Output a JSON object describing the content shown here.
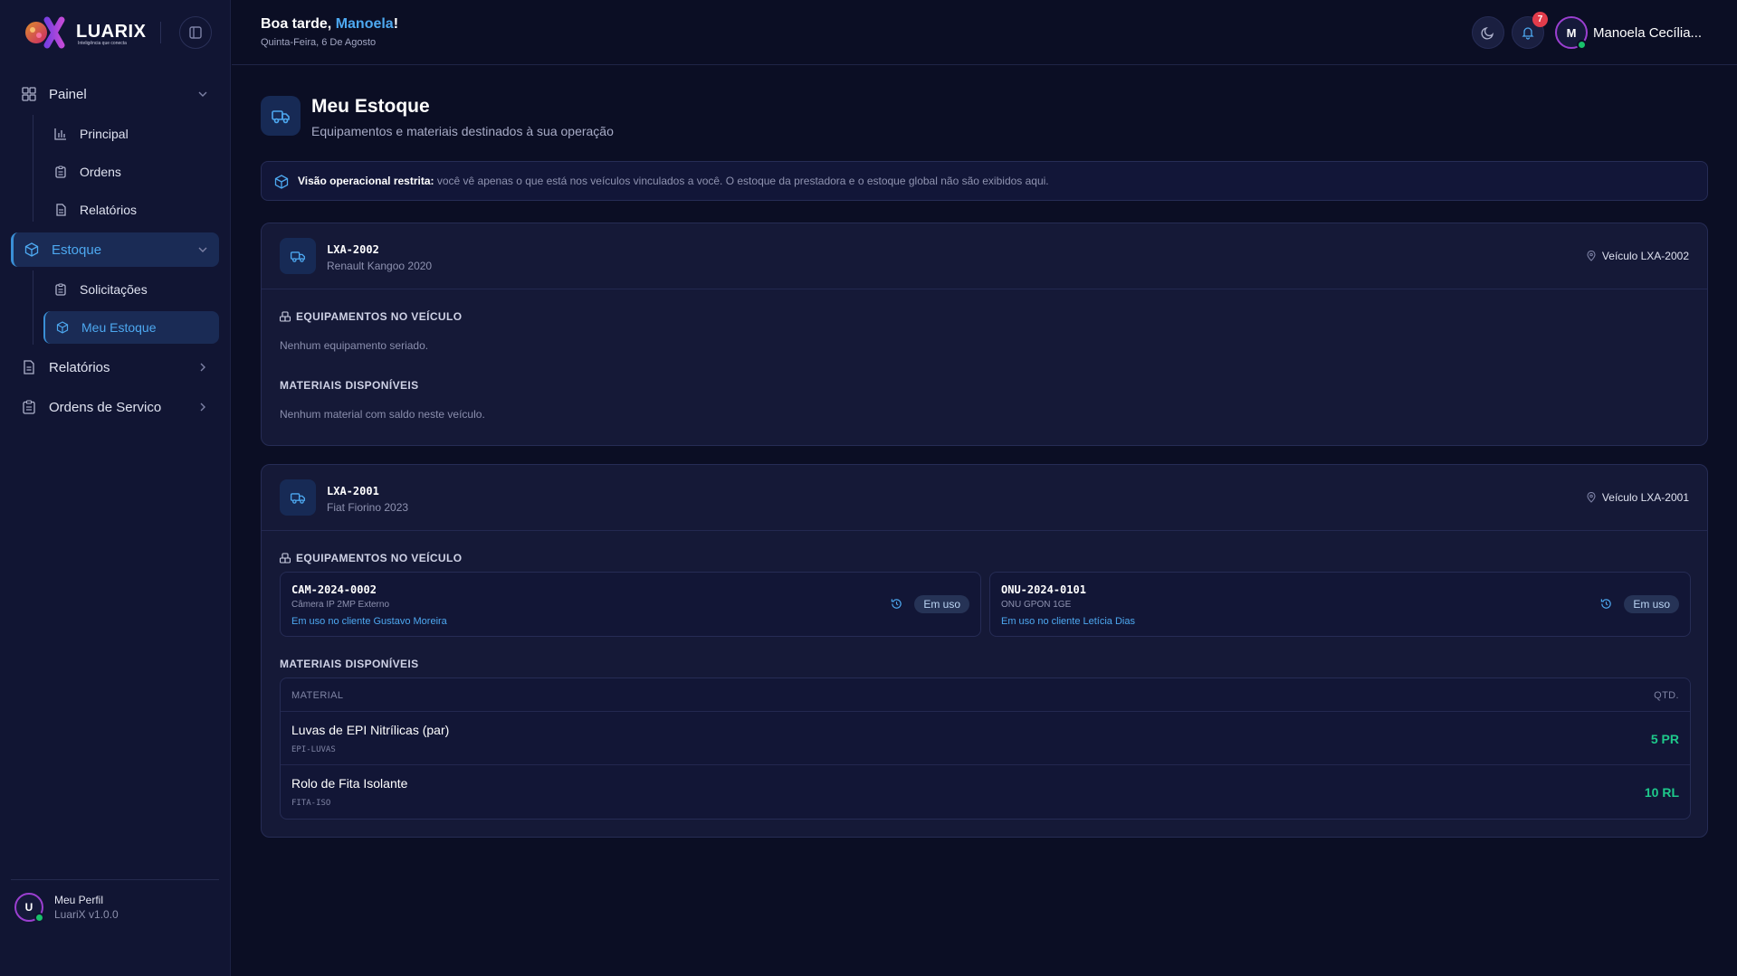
{
  "app": {
    "logo_text": "LUARIX",
    "logo_tagline": "Inteligência que conecta"
  },
  "sidebar": {
    "items": [
      {
        "label": "Painel",
        "children": [
          {
            "label": "Principal"
          },
          {
            "label": "Ordens"
          },
          {
            "label": "Relatórios"
          }
        ]
      },
      {
        "label": "Estoque",
        "active": true,
        "children": [
          {
            "label": "Solicitações"
          },
          {
            "label": "Meu Estoque",
            "active": true
          }
        ]
      },
      {
        "label": "Relatórios"
      },
      {
        "label": "Ordens de Servico"
      }
    ],
    "profile": {
      "initial": "U",
      "label": "Meu Perfil",
      "version": "LuariX v1.0.0"
    }
  },
  "header": {
    "greeting_prefix": "Boa tarde, ",
    "user_first_name": "Manoela",
    "greeting_suffix": "!",
    "date": "Quinta-Feira, 6 De Agosto",
    "notification_count": "7",
    "user_initial": "M",
    "user_name": "Manoela Cecília..."
  },
  "page": {
    "title": "Meu Estoque",
    "subtitle": "Equipamentos e materiais destinados à sua operação",
    "notice_bold": "Visão operacional restrita:",
    "notice_text": " você vê apenas o que está nos veículos vinculados a você. O estoque da prestadora e o estoque global não são exibidos aqui."
  },
  "vehicles": [
    {
      "plate": "LXA-2002",
      "model": "Renault Kangoo 2020",
      "location": "Veículo LXA-2002",
      "equipment_title": "EQUIPAMENTOS NO VEÍCULO",
      "equipment_empty": "Nenhum equipamento seriado.",
      "materials_title": "MATERIAIS DISPONÍVEIS",
      "materials_empty": "Nenhum material com saldo neste veículo."
    },
    {
      "plate": "LXA-2001",
      "model": "Fiat Fiorino 2023",
      "location": "Veículo LXA-2001",
      "equipment_title": "EQUIPAMENTOS NO VEÍCULO",
      "equipment": [
        {
          "code": "CAM-2024-0002",
          "description": "Câmera IP 2MP Externo",
          "client": "Em uso no cliente Gustavo Moreira",
          "status": "Em uso"
        },
        {
          "code": "ONU-2024-0101",
          "description": "ONU GPON 1GE",
          "client": "Em uso no cliente Letícia Dias",
          "status": "Em uso"
        }
      ],
      "materials_title": "MATERIAIS DISPONÍVEIS",
      "materials_columns": {
        "material": "MATERIAL",
        "qty": "QTD."
      },
      "materials": [
        {
          "name": "Luvas de EPI Nitrílicas (par)",
          "sku": "EPI-LUVAS",
          "qty": "5 PR"
        },
        {
          "name": "Rolo de Fita Isolante",
          "sku": "FITA-ISO",
          "qty": "10 RL"
        }
      ]
    }
  ],
  "colors": {
    "accent": "#4da8f0",
    "background": "#0b0e24",
    "sidebar": "#111533",
    "qty": "#1ec98b",
    "badge": "#e23c4b"
  }
}
